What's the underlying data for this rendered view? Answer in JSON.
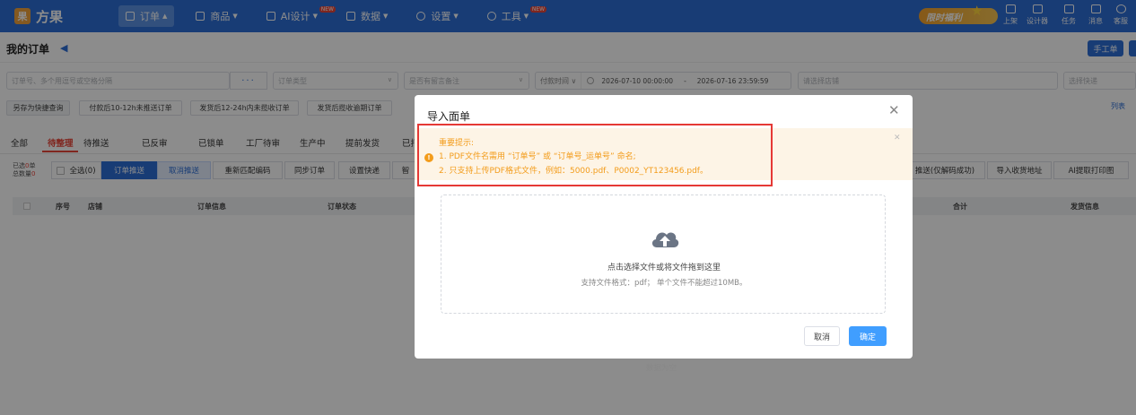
{
  "app": {
    "logo_text": "方果",
    "logo_glyph": "果"
  },
  "nav": {
    "items": [
      {
        "label": "订单",
        "caret": "▲",
        "active": true
      },
      {
        "label": "商品",
        "caret": "▼"
      },
      {
        "label": "AI设计",
        "caret": "▼",
        "badge": "NEW"
      },
      {
        "label": "数据",
        "caret": "▼"
      },
      {
        "label": "设置",
        "caret": "▼"
      },
      {
        "label": "工具",
        "caret": "▼",
        "badge": "NEW"
      }
    ],
    "promo": "限时福利",
    "tools": [
      "上架",
      "设计器",
      "任务",
      "消息",
      "客服"
    ]
  },
  "header": {
    "title": "我的订单",
    "manual_btn": "手工单"
  },
  "filters": {
    "order_no": "订单号、多个用逗号或空格分隔",
    "order_type": "订单类型",
    "memo": "是否有留言备注",
    "time_type": "付款时间",
    "date_from": "2026-07-10 00:00:00",
    "date_sep": "-",
    "date_to": "2026-07-16 23:59:59",
    "store": "请选择店铺",
    "express": "选择快递"
  },
  "quick": [
    "另存为快捷查询",
    "付款后10-12h未推送订单",
    "发货后12-24h内未揽收订单",
    "发货后揽收逾期订单"
  ],
  "column_settings": "列表",
  "tabs": [
    "全部",
    "待整理",
    "待推送",
    "已反审",
    "已锁单",
    "工厂待审",
    "生产中",
    "提前发货",
    "已打"
  ],
  "actions": {
    "selected_label": "已选",
    "selected_count": "0",
    "unit": "单",
    "total_label": "总数量",
    "total_count": "0",
    "select_all": "全选(0)",
    "buttons": [
      "订单推送",
      "取消推送",
      "重新匹配编码",
      "同步订单",
      "设置快递",
      "智"
    ],
    "right_buttons": [
      "推送(仅解码成功)",
      "导入收货地址",
      "AI提取打印图"
    ]
  },
  "table": {
    "headers": [
      "序号",
      "店铺",
      "订单信息",
      "订单状态",
      "合计",
      "发货信息"
    ],
    "empty": "数据为空"
  },
  "modal": {
    "title": "导入面单",
    "alert_title": "重要提示:",
    "alert_line1": "1. PDF文件名需用 “订单号” 或 “订单号_运单号” 命名;",
    "alert_line2": "2. 只支持上传PDF格式文件，例如：5000.pdf、P0002_YT123456.pdf。",
    "upload_text": "点击选择文件或将文件拖到这里",
    "upload_hint": "支持文件格式：pdf； 单个文件不能超过10MB。",
    "cancel": "取消",
    "confirm": "确定"
  },
  "colors": {
    "primary": "#2c6ed6",
    "accent_red": "#e9453a",
    "warning": "#f39c1b",
    "highlight_box": "#e53935"
  }
}
